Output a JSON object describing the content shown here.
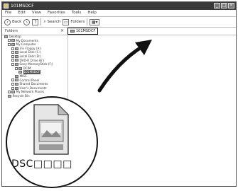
{
  "window": {
    "title": "101MSDCF",
    "controls": [
      "_",
      "□",
      "×"
    ]
  },
  "menubar": {
    "items": [
      "File",
      "Edit",
      "View",
      "Favorites",
      "Tools",
      "Help"
    ]
  },
  "toolbar": {
    "back_label": "Back",
    "forward_label": "›",
    "up_label": "↑",
    "search_label": "Search",
    "folders_label": "Folders",
    "views_label": "▦▾"
  },
  "folders_panel": {
    "title": "Folders",
    "close_label": "×",
    "selected_folder": "101MSDCF"
  },
  "tree": [
    {
      "label": "Desktop",
      "indent": 0,
      "toggle": false
    },
    {
      "label": "My Documents",
      "indent": 1,
      "toggle": true
    },
    {
      "label": "My Computer",
      "indent": 1,
      "toggle": true
    },
    {
      "label": "3½ Floppy (A:)",
      "indent": 2,
      "toggle": true
    },
    {
      "label": "Local Disk (C:)",
      "indent": 2,
      "toggle": true
    },
    {
      "label": "Local Disk (D:)",
      "indent": 2,
      "toggle": true
    },
    {
      "label": "DVD-R Drive (E:)",
      "indent": 2,
      "toggle": true
    },
    {
      "label": "Sony MemoryStick (F:)",
      "indent": 2,
      "toggle": true
    },
    {
      "label": "DCIM",
      "indent": 3,
      "toggle": true
    },
    {
      "label": "101MSDCF",
      "indent": 4,
      "toggle": false,
      "selected": true
    },
    {
      "label": "MISC",
      "indent": 3,
      "toggle": false
    },
    {
      "label": "Control Panel",
      "indent": 2,
      "toggle": true
    },
    {
      "label": "Shared Documents",
      "indent": 2,
      "toggle": true
    },
    {
      "label": "User's Documents",
      "indent": 2,
      "toggle": true
    },
    {
      "label": "My Network Places",
      "indent": 1,
      "toggle": true
    },
    {
      "label": "Recycle Bin",
      "indent": 1,
      "toggle": false
    }
  ],
  "zoom_callout": {
    "file_label": "DSC□□□□",
    "file_icon": "image-file-icon"
  },
  "colors": {
    "titlebar": "#3a3a3a",
    "selected": "#555555"
  }
}
